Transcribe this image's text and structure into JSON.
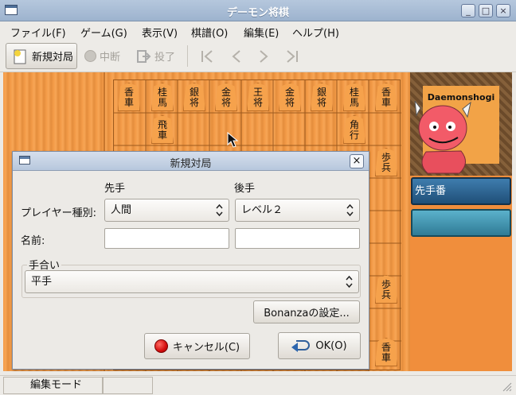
{
  "window": {
    "title": "デーモン将棋",
    "min": "_",
    "max": "□",
    "close": "×"
  },
  "menu": [
    "ファイル(F)",
    "ゲーム(G)",
    "表示(V)",
    "棋譜(O)",
    "編集(E)",
    "ヘルプ(H)"
  ],
  "toolbar": {
    "new_game": "新規対局",
    "interrupt": "中断",
    "resign": "投了"
  },
  "mascot": {
    "label": "Daemonshogi"
  },
  "turn_label": "先手番",
  "status": {
    "mode": "編集モード"
  },
  "dialog": {
    "title": "新規対局",
    "sente_header": "先手",
    "gote_header": "後手",
    "player_type_label": "プレイヤー種別:",
    "sente_player": "人間",
    "gote_player": "レベル２",
    "name_label": "名前:",
    "sente_name": "",
    "gote_name": "",
    "handicap_group": "手合い",
    "handicap_value": "平手",
    "bonanza_button": "Bonanzaの設定...",
    "cancel_button": "キャンセル(C)",
    "ok_button": "OK(O)"
  },
  "pieces": [
    {
      "top": "香",
      "bottom": "車"
    },
    {
      "top": "桂",
      "bottom": "馬"
    },
    {
      "top": "銀",
      "bottom": "将"
    },
    {
      "top": "金",
      "bottom": "将"
    },
    {
      "top": "王",
      "bottom": "将"
    },
    {
      "top": "金",
      "bottom": "将"
    },
    {
      "top": "銀",
      "bottom": "将"
    },
    {
      "top": "桂",
      "bottom": "馬"
    },
    {
      "top": "香",
      "bottom": "車"
    },
    {
      "top": "飛",
      "bottom": "車"
    },
    {
      "top": "角",
      "bottom": "行"
    },
    {
      "top": "歩",
      "bottom": "兵"
    },
    {
      "top": "歩",
      "bottom": "兵"
    },
    {
      "top": "香",
      "bottom": "車"
    }
  ]
}
